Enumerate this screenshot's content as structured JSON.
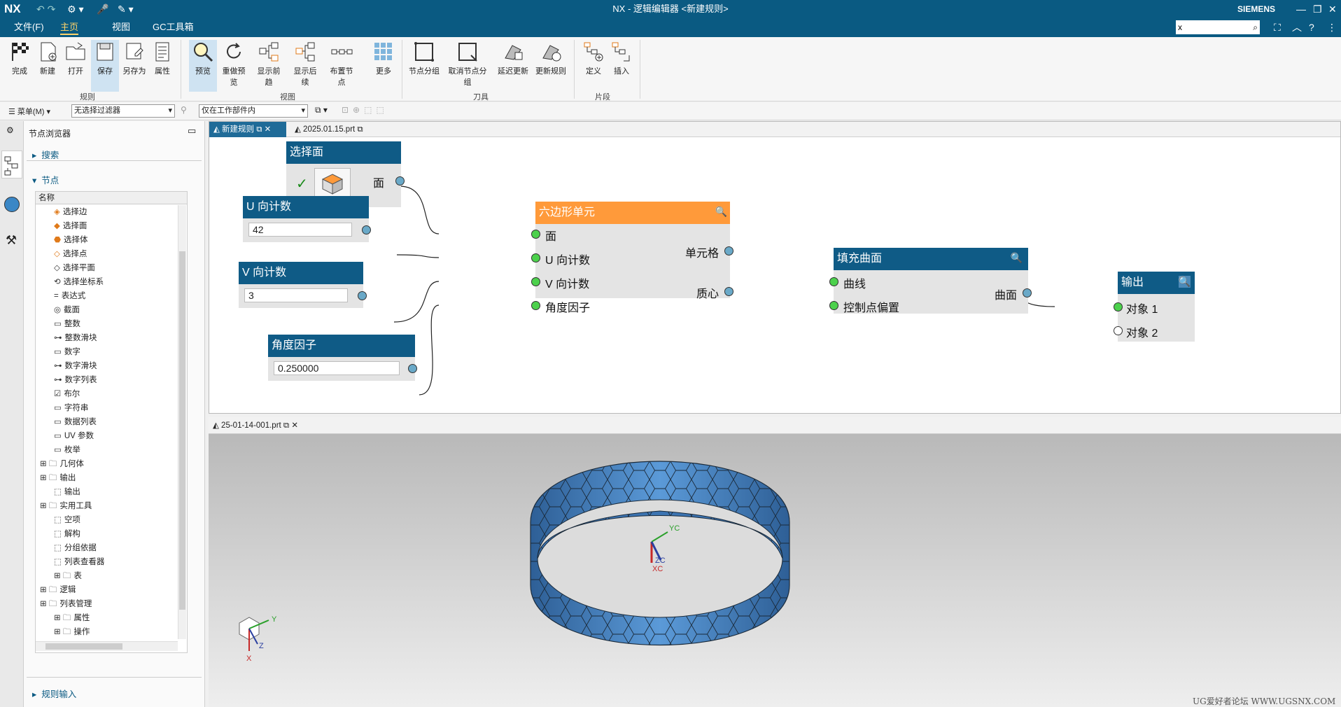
{
  "app": {
    "logo": "NX",
    "title": "NX - 逻辑编辑器 <新建规则>",
    "brand": "SIEMENS",
    "search_value": "x"
  },
  "menu": {
    "items": [
      "文件(F)",
      "主页",
      "视图",
      "GC工具箱"
    ],
    "active": "主页"
  },
  "ribbon": {
    "buttons": [
      "完成",
      "新建",
      "打开",
      "保存",
      "另存为",
      "属性",
      "预览",
      "重做预览",
      "显示前趋",
      "显示后续",
      "布置节点",
      "更多",
      "节点分组",
      "取消节点分组",
      "延迟更新",
      "更新规则",
      "定义",
      "插入"
    ],
    "groups": [
      "规则",
      "视图",
      "刀具",
      "片段"
    ]
  },
  "selbar": {
    "menu_label": "菜单(M)",
    "filter": "无选择过滤器",
    "scope": "仅在工作部件内"
  },
  "nav": {
    "title": "节点浏览器",
    "sections": {
      "search": "搜索",
      "nodes": "节点",
      "rule_input": "规则输入"
    },
    "column": "名称",
    "items": [
      "选择边",
      "选择面",
      "选择体",
      "选择点",
      "选择平面",
      "选择坐标系",
      "表达式",
      "截面",
      "整数",
      "整数滑块",
      "数字",
      "数字滑块",
      "数字列表",
      "布尔",
      "字符串",
      "数据列表",
      "UV 参数",
      "枚举",
      "几何体",
      "输出",
      "输出",
      "实用工具",
      "空项",
      "解构",
      "分组依据",
      "列表查看器",
      "表",
      "逻辑",
      "列表管理",
      "属性",
      "操作",
      "搜索"
    ]
  },
  "tabs": {
    "editor_tab1": "新建规则",
    "editor_tab2": "2025.01.15.prt",
    "viewport_tab": "25-01-14-001.prt"
  },
  "graph": {
    "select_face": {
      "title": "选择面",
      "out": "面"
    },
    "u_count": {
      "title": "U 向计数",
      "value": "42"
    },
    "v_count": {
      "title": "V 向计数",
      "value": "3"
    },
    "angle": {
      "title": "角度因子",
      "value": "0.250000"
    },
    "hex": {
      "title": "六边形单元",
      "in1": "面",
      "in2": "U 向计数",
      "in3": "V 向计数",
      "in4": "角度因子",
      "out1": "单元格",
      "out2": "质心"
    },
    "fill": {
      "title": "填充曲面",
      "in1": "曲线",
      "in2": "控制点偏置",
      "out": "曲面"
    },
    "output": {
      "title": "输出",
      "in1": "对象 1",
      "in2": "对象 2"
    }
  },
  "viewport": {
    "axes": {
      "yc": "YC",
      "zc": "ZC",
      "xc": "XC",
      "x": "X",
      "y": "Y",
      "z": "Z"
    },
    "watermark": "UG爱好者论坛 WWW.UGSNX.COM"
  },
  "colors": {
    "titlebar": "#0a5a82",
    "node_header": "#0f5b86",
    "node_header_active": "#ff9a3a",
    "ring": "#4a86c8"
  }
}
